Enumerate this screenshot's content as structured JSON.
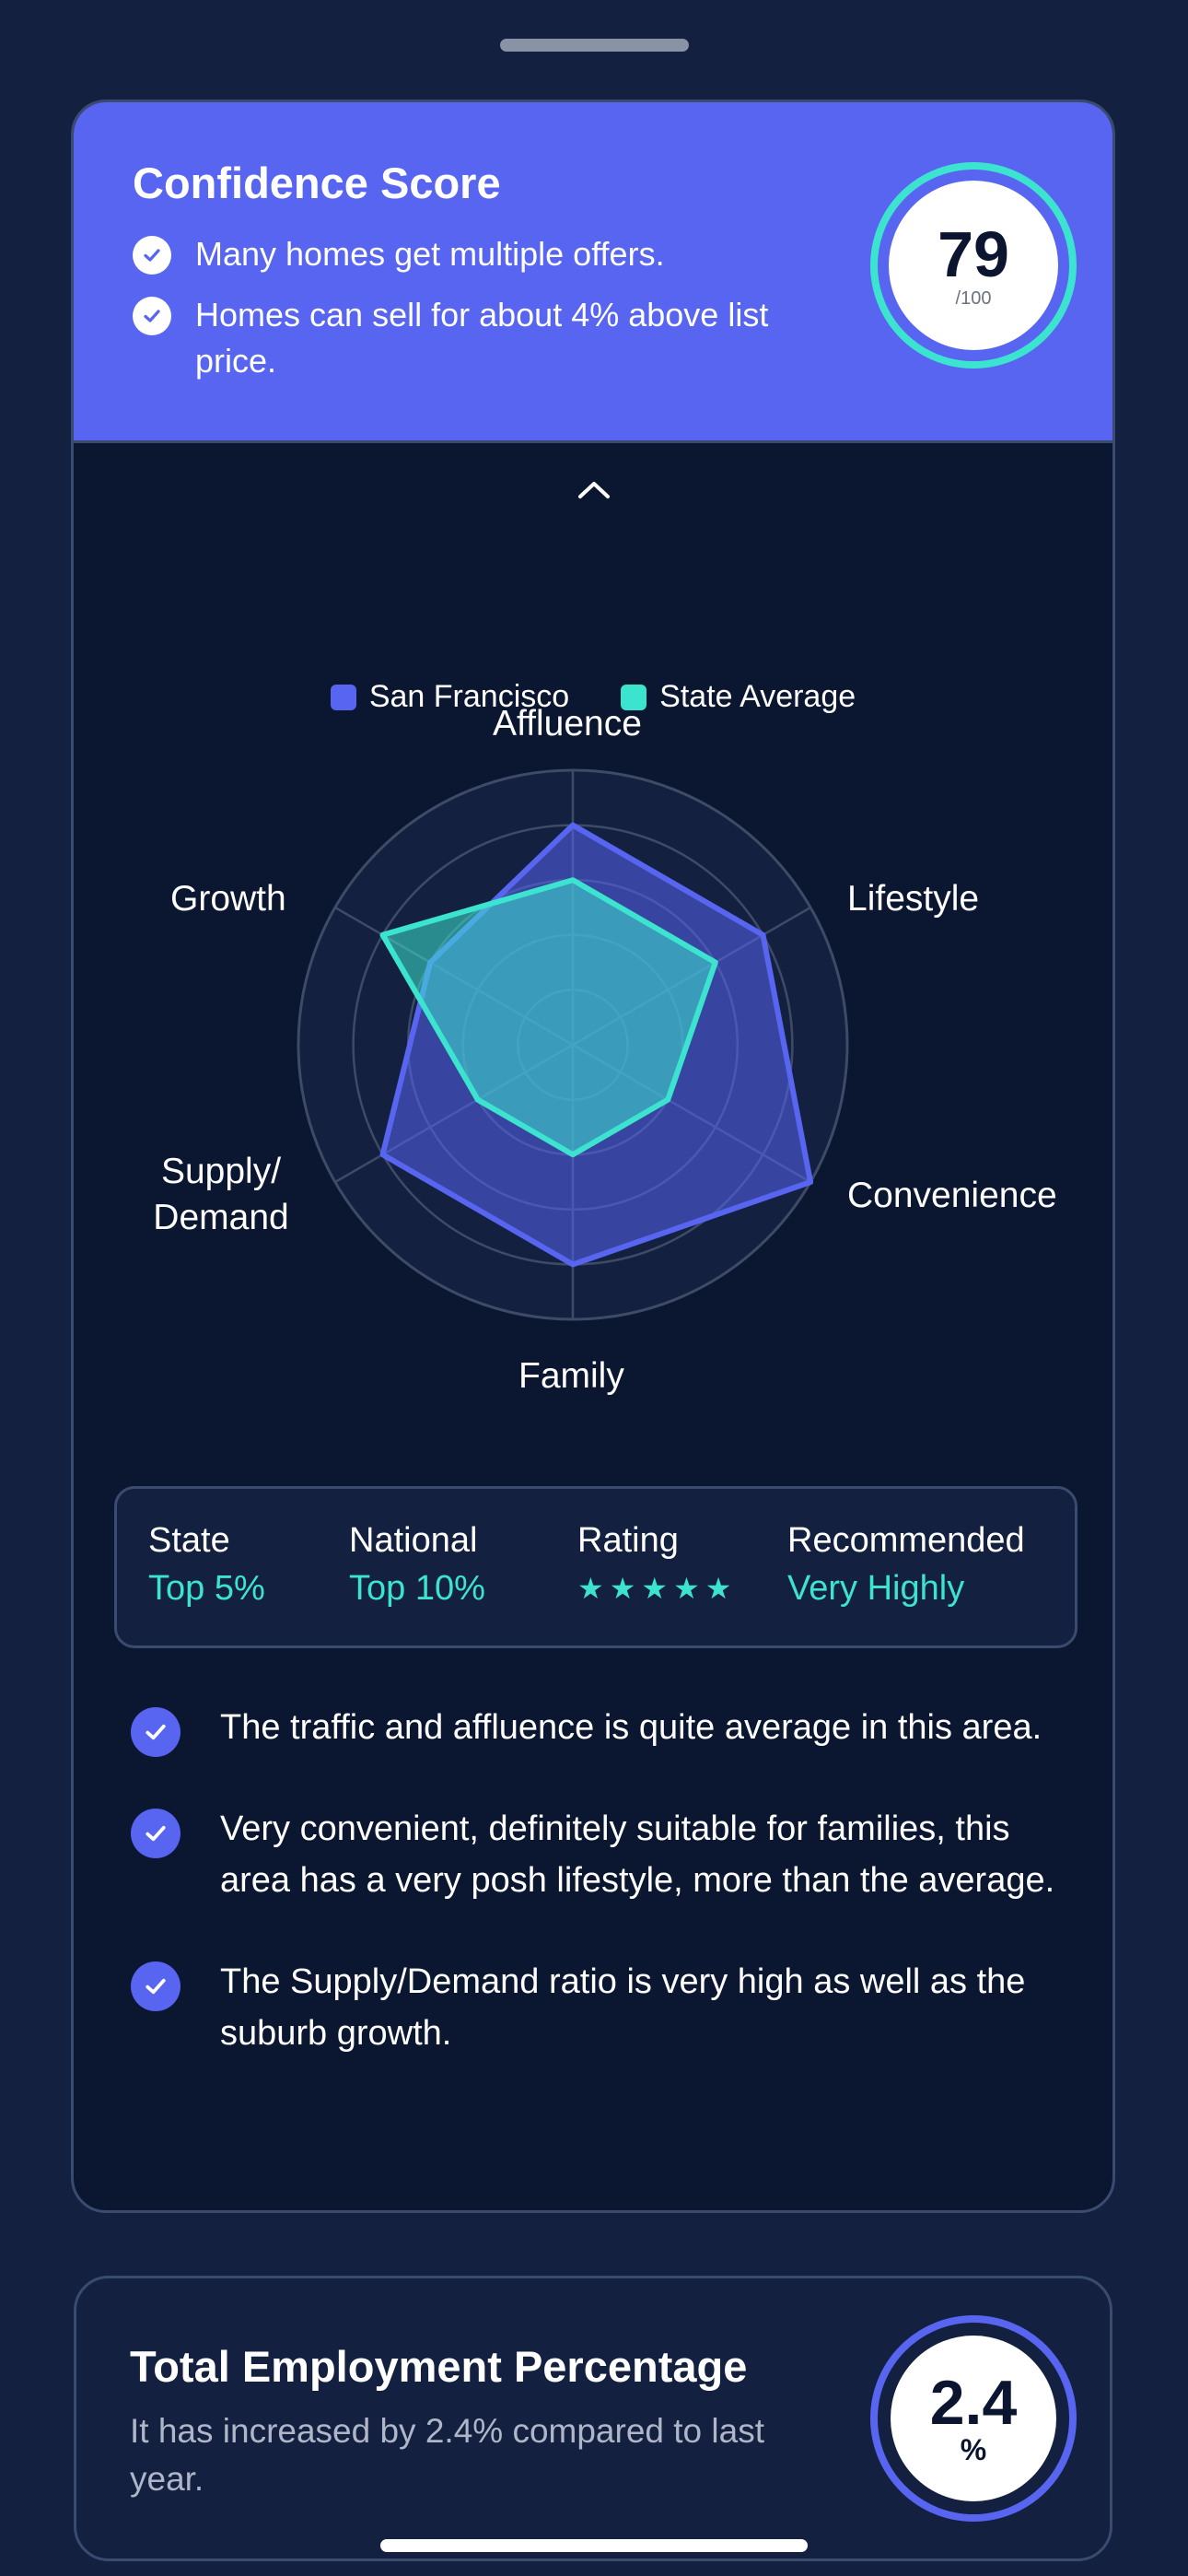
{
  "confidence": {
    "title": "Confidence Score",
    "points": [
      "Many homes get multiple offers.",
      "Homes can sell for about 4% above list price."
    ],
    "score": "79",
    "score_max": "/100"
  },
  "chart_data": {
    "type": "radar",
    "axes": [
      "Affluence",
      "Lifestyle",
      "Convenience",
      "Family",
      "Supply/ Demand",
      "Growth"
    ],
    "range": [
      0,
      5
    ],
    "grid_levels": 5,
    "series": [
      {
        "name": "San Francisco",
        "values": [
          4,
          4,
          5,
          4,
          4,
          3
        ],
        "color": "#5765f0"
      },
      {
        "name": "State Average",
        "values": [
          3,
          3,
          2,
          2,
          2,
          4
        ],
        "color": "#3ce4cf"
      }
    ],
    "legend_position": "top"
  },
  "stats": [
    {
      "label": "State",
      "value": "Top 5%"
    },
    {
      "label": "National",
      "value": "Top 10%"
    },
    {
      "label": "Rating",
      "stars": 5
    },
    {
      "label": "Recommended",
      "value": "Very Highly"
    }
  ],
  "insights": [
    "The traffic and affluence is quite average in this area.",
    "Very convenient, definitely suitable for families, this area has a very posh lifestyle, more than the average.",
    "The Supply/Demand ratio is very high as well as the suburb growth."
  ],
  "employment": {
    "title": "Total Employment Percentage",
    "subtitle": "It has increased by 2.4% compared to last year.",
    "value": "2.4",
    "unit": "%"
  },
  "colors": {
    "background": "#13203f",
    "card": "#0b1631",
    "accent": "#5765f0",
    "teal": "#3ce4cf"
  },
  "icons": {
    "check": "check-icon",
    "chevron": "chevron-up-icon",
    "star": "star-icon"
  }
}
